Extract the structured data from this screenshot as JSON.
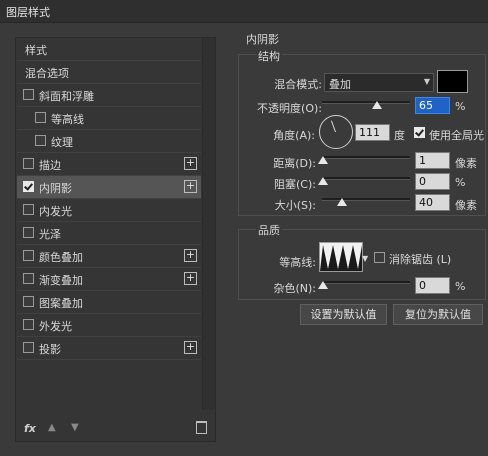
{
  "window": {
    "title": "图层样式"
  },
  "left_panel": {
    "header": "样式",
    "blend_options": "混合选项",
    "items": [
      {
        "label": "斜面和浮雕",
        "checked": false,
        "plus": false,
        "indent": false
      },
      {
        "label": "等高线",
        "checked": false,
        "plus": false,
        "indent": true
      },
      {
        "label": "纹理",
        "checked": false,
        "plus": false,
        "indent": true
      },
      {
        "label": "描边",
        "checked": false,
        "plus": true,
        "indent": false
      },
      {
        "label": "内阴影",
        "checked": true,
        "plus": true,
        "indent": false,
        "selected": true
      },
      {
        "label": "内发光",
        "checked": false,
        "plus": false,
        "indent": false
      },
      {
        "label": "光泽",
        "checked": false,
        "plus": false,
        "indent": false
      },
      {
        "label": "颜色叠加",
        "checked": false,
        "plus": true,
        "indent": false
      },
      {
        "label": "渐变叠加",
        "checked": false,
        "plus": true,
        "indent": false
      },
      {
        "label": "图案叠加",
        "checked": false,
        "plus": false,
        "indent": false
      },
      {
        "label": "外发光",
        "checked": false,
        "plus": false,
        "indent": false
      },
      {
        "label": "投影",
        "checked": false,
        "plus": true,
        "indent": false
      }
    ],
    "plus_glyph": "+",
    "fx_label": "fx"
  },
  "inner_shadow": {
    "section_title": "内阴影",
    "structure": {
      "title": "结构",
      "blend_mode_label": "混合模式:",
      "blend_mode_value": "叠加",
      "shadow_color": "#000000",
      "opacity_label": "不透明度(O):",
      "opacity_value": "65",
      "opacity_unit": "%",
      "angle_label": "角度(A):",
      "angle_value": "111",
      "angle_unit": "度",
      "global_light_label": "使用全局光",
      "global_light_checked": true,
      "distance_label": "距离(D):",
      "distance_value": "1",
      "distance_unit": "像素",
      "choke_label": "阻塞(C):",
      "choke_value": "0",
      "choke_unit": "%",
      "size_label": "大小(S):",
      "size_value": "40",
      "size_unit": "像素"
    },
    "quality": {
      "title": "品质",
      "contour_label": "等高线:",
      "antialias_label": "消除锯齿 (L)",
      "antialias_checked": false,
      "noise_label": "杂色(N):",
      "noise_value": "0",
      "noise_unit": "%"
    },
    "buttons": {
      "make_default": "设置为默认值",
      "reset_default": "复位为默认值"
    }
  }
}
